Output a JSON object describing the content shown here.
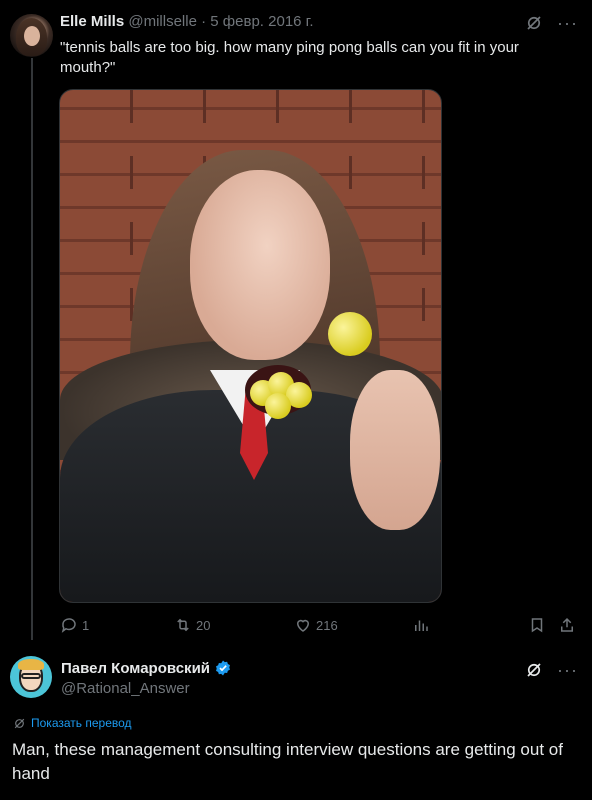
{
  "tweet1": {
    "author_name": "Elle Mills",
    "handle": "@millselle",
    "separator": " · ",
    "date": "5 февр. 2016 г.",
    "text": "\"tennis balls are too big. how many ping pong balls can you fit in your mouth?\"",
    "image_icon": "photo-ping-pong-balls",
    "actions": {
      "reply_count": "1",
      "retweet_count": "20",
      "like_count": "216"
    }
  },
  "tweet2": {
    "author_name": "Павел Комаровский",
    "handle": "@Rational_Answer",
    "translate_label": "Показать перевод",
    "text": "Man, these management consulting interview questions are getting out of hand"
  },
  "colors": {
    "background": "#000000",
    "text": "#e7e9ea",
    "muted": "#71767b",
    "accent": "#1d9bf0"
  },
  "icons": [
    "grok-icon",
    "more-icon",
    "reply-icon",
    "retweet-icon",
    "like-icon",
    "views-icon",
    "bookmark-icon",
    "share-icon",
    "verified-badge-icon",
    "translate-icon"
  ]
}
